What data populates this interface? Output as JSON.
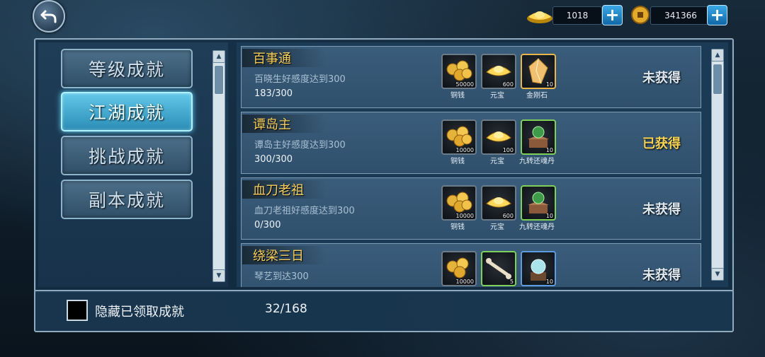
{
  "topbar": {
    "ingot_value": "1018",
    "coin_value": "341366"
  },
  "tabs": [
    {
      "label": "等级成就",
      "active": false
    },
    {
      "label": "江湖成就",
      "active": true
    },
    {
      "label": "挑战成就",
      "active": false
    },
    {
      "label": "副本成就",
      "active": false
    }
  ],
  "achievements": [
    {
      "title": "百事通",
      "desc": "百晓生好感度达到300",
      "progress": "183/300",
      "status": "未获得",
      "rewards": [
        {
          "name": "铜钱",
          "qty": "50000",
          "icon": "coins-icon"
        },
        {
          "name": "元宝",
          "qty": "600",
          "icon": "ingot-icon"
        },
        {
          "name": "金刚石",
          "qty": "10",
          "icon": "diamond-icon"
        }
      ]
    },
    {
      "title": "谭岛主",
      "desc": "谭岛主好感度达到300",
      "progress": "300/300",
      "status": "已获得",
      "rewards": [
        {
          "name": "铜钱",
          "qty": "10000",
          "icon": "coins-icon"
        },
        {
          "name": "元宝",
          "qty": "100",
          "icon": "ingot-icon"
        },
        {
          "name": "九转还魂丹",
          "qty": "10",
          "icon": "pill-icon"
        }
      ]
    },
    {
      "title": "血刀老祖",
      "desc": "血刀老祖好感度达到300",
      "progress": "0/300",
      "status": "未获得",
      "rewards": [
        {
          "name": "铜钱",
          "qty": "10000",
          "icon": "coins-icon"
        },
        {
          "name": "元宝",
          "qty": "600",
          "icon": "ingot-icon"
        },
        {
          "name": "九转还魂丹",
          "qty": "10",
          "icon": "pill-icon"
        }
      ]
    },
    {
      "title": "绕梁三日",
      "desc": "琴艺到达300",
      "progress": "",
      "status": "未获得",
      "rewards": [
        {
          "name": "",
          "qty": "10000",
          "icon": "coins-icon"
        },
        {
          "name": "",
          "qty": "5",
          "icon": "bone-icon"
        },
        {
          "name": "",
          "qty": "10",
          "icon": "orb-icon"
        }
      ]
    }
  ],
  "bottom": {
    "hide_label": "隐藏已领取成就",
    "count": "32/168"
  },
  "colors": {
    "title_gold": "#f6cf5d",
    "active_tab": "#62c8e9",
    "got_status": "#f6d153"
  }
}
